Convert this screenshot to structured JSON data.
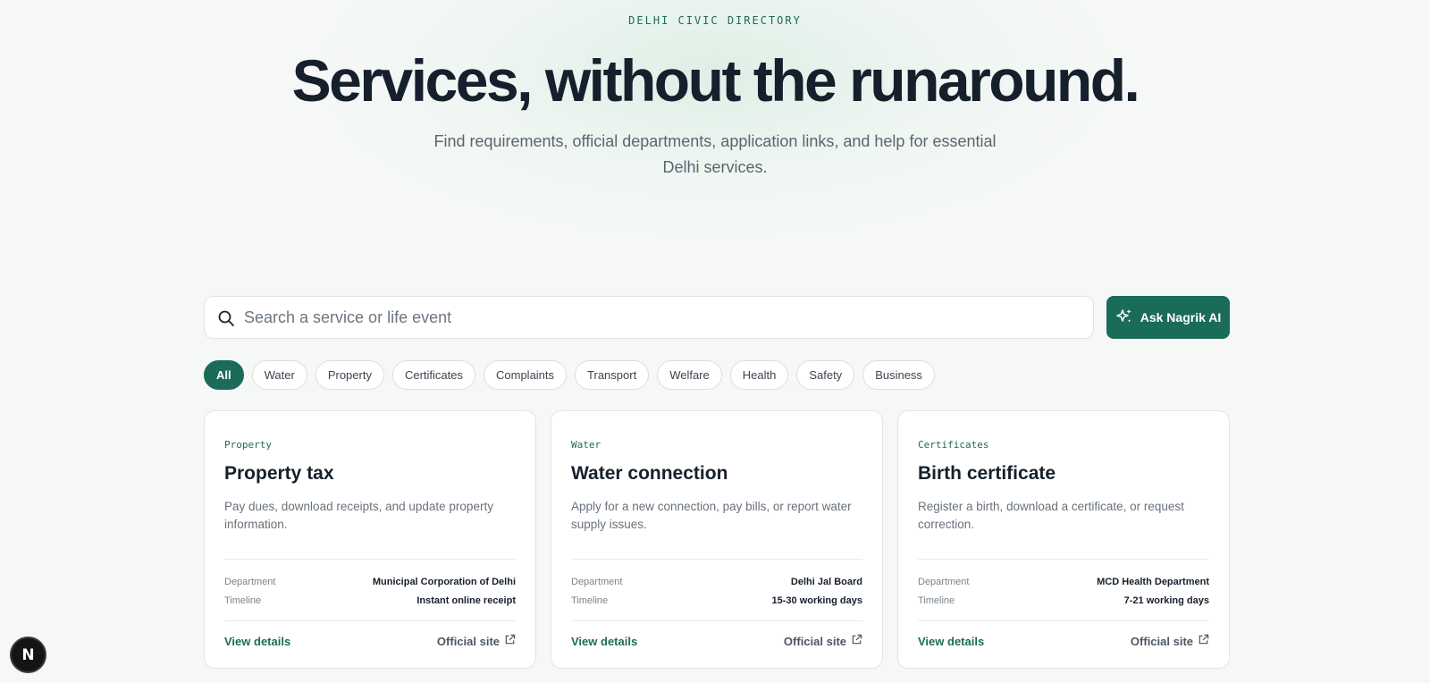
{
  "hero": {
    "eyebrow": "DELHI CIVIC DIRECTORY",
    "headline": "Services, without the runaround.",
    "subhead": "Find requirements, official departments, application links, and help for essential Delhi services."
  },
  "search": {
    "placeholder": "Search a service or life event",
    "value": ""
  },
  "ask_button": {
    "label": "Ask Nagrik AI",
    "icon": "sparkles-icon"
  },
  "filters": {
    "active": "All",
    "items": [
      "All",
      "Water",
      "Property",
      "Certificates",
      "Complaints",
      "Transport",
      "Welfare",
      "Health",
      "Safety",
      "Business"
    ]
  },
  "cards": [
    {
      "category": "Property",
      "title": "Property tax",
      "description": "Pay dues, download receipts, and update property information.",
      "department_label": "Department",
      "department": "Municipal Corporation of Delhi",
      "timeline_label": "Timeline",
      "timeline": "Instant online receipt",
      "view_label": "View details",
      "official_label": "Official site"
    },
    {
      "category": "Water",
      "title": "Water connection",
      "description": "Apply for a new connection, pay bills, or report water supply issues.",
      "department_label": "Department",
      "department": "Delhi Jal Board",
      "timeline_label": "Timeline",
      "timeline": "15-30 working days",
      "view_label": "View details",
      "official_label": "Official site"
    },
    {
      "category": "Certificates",
      "title": "Birth certificate",
      "description": "Register a birth, download a certificate, or request correction.",
      "department_label": "Department",
      "department": "MCD Health Department",
      "timeline_label": "Timeline",
      "timeline": "7-21 working days",
      "view_label": "View details",
      "official_label": "Official site"
    }
  ],
  "fab": {
    "label": "N"
  },
  "colors": {
    "accent": "#1b6b59",
    "background": "#f6f8f7",
    "text": "#16202c"
  }
}
